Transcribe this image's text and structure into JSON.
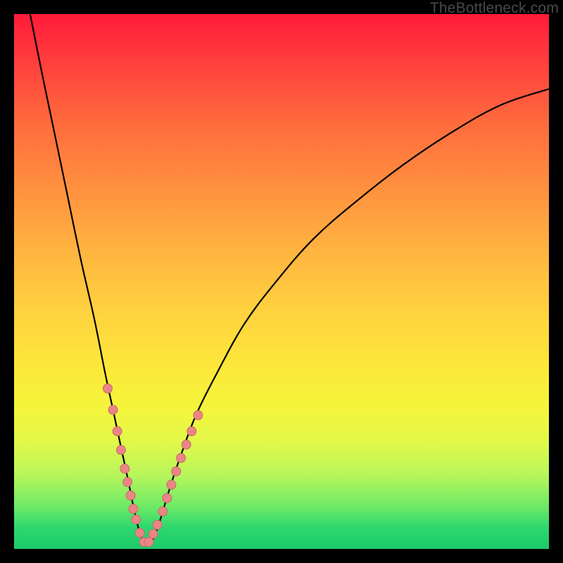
{
  "watermark": "TheBottleneck.com",
  "colors": {
    "frame": "#000000",
    "curve": "#000000",
    "dot_fill": "#e98585",
    "dot_stroke": "#c96a6a"
  },
  "chart_data": {
    "type": "line",
    "title": "",
    "xlabel": "",
    "ylabel": "",
    "xlim": [
      0,
      100
    ],
    "ylim": [
      0,
      100
    ],
    "notes": "V-shaped bottleneck curve over rainbow gradient; minimum near x≈24. Left branch is near-vertical, right branch rises with decreasing slope. Dots cluster on both branches near the bottom.",
    "series": [
      {
        "name": "curve",
        "x": [
          3.0,
          5.0,
          7.5,
          10.0,
          12.5,
          15.0,
          17.0,
          18.5,
          20.0,
          21.5,
          22.5,
          23.5,
          24.5,
          25.5,
          26.5,
          27.5,
          29.0,
          31.0,
          34.0,
          38.0,
          43.0,
          49.0,
          56.0,
          64.0,
          73.0,
          82.0,
          91.0,
          100.0
        ],
        "y": [
          100.0,
          90.0,
          78.0,
          66.0,
          54.0,
          43.0,
          33.0,
          26.0,
          19.0,
          12.0,
          7.0,
          3.0,
          1.0,
          1.0,
          3.0,
          6.0,
          11.0,
          17.0,
          25.0,
          33.0,
          42.0,
          50.0,
          58.0,
          65.0,
          72.0,
          78.0,
          83.0,
          86.0
        ]
      }
    ],
    "dots": [
      {
        "x": 17.5,
        "y": 30.0
      },
      {
        "x": 18.5,
        "y": 26.0
      },
      {
        "x": 19.3,
        "y": 22.0
      },
      {
        "x": 20.0,
        "y": 18.5
      },
      {
        "x": 20.7,
        "y": 15.0
      },
      {
        "x": 21.2,
        "y": 12.5
      },
      {
        "x": 21.8,
        "y": 10.0
      },
      {
        "x": 22.3,
        "y": 7.5
      },
      {
        "x": 22.8,
        "y": 5.5
      },
      {
        "x": 23.5,
        "y": 3.0
      },
      {
        "x": 24.3,
        "y": 1.3
      },
      {
        "x": 25.2,
        "y": 1.3
      },
      {
        "x": 26.0,
        "y": 2.8
      },
      {
        "x": 26.8,
        "y": 4.5
      },
      {
        "x": 27.8,
        "y": 7.0
      },
      {
        "x": 28.6,
        "y": 9.5
      },
      {
        "x": 29.4,
        "y": 12.0
      },
      {
        "x": 30.3,
        "y": 14.5
      },
      {
        "x": 31.2,
        "y": 17.0
      },
      {
        "x": 32.2,
        "y": 19.5
      },
      {
        "x": 33.2,
        "y": 22.0
      },
      {
        "x": 34.4,
        "y": 25.0
      }
    ]
  }
}
